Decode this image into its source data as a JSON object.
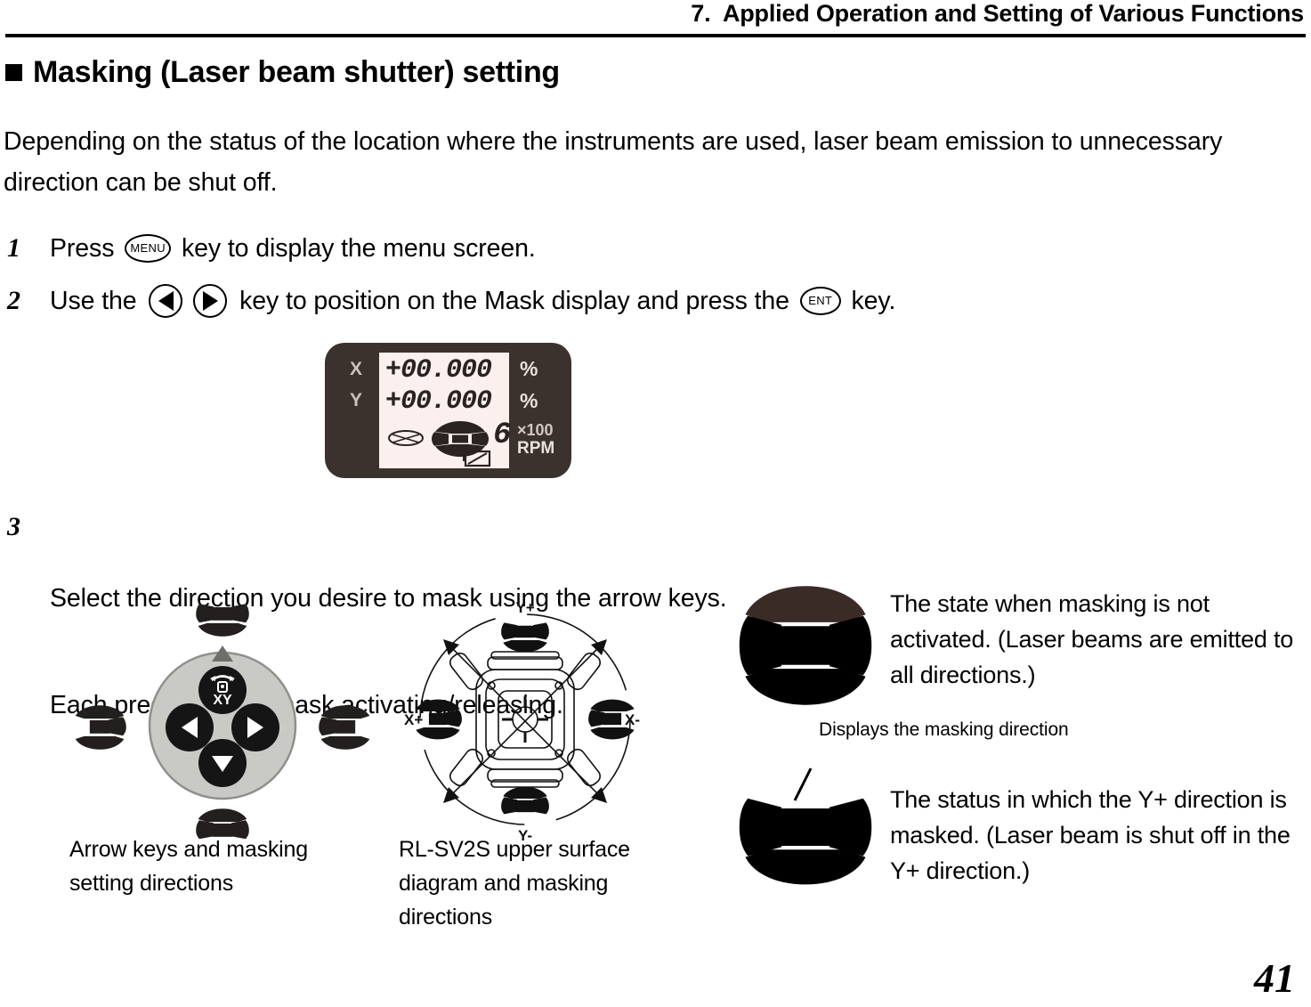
{
  "header": {
    "title": "7.  Applied Operation and Setting of Various Functions"
  },
  "section": {
    "heading": "Masking (Laser beam shutter) setting",
    "intro": "Depending on the status of the location where the instruments are used, laser beam emission to unnecessary direction can be shut off."
  },
  "steps": [
    {
      "number": "1",
      "text_before": "Press ",
      "key1": "MENU",
      "text_after": " key to display the menu screen."
    },
    {
      "number": "2",
      "text_before": "Use the ",
      "key_left": "left-arrow",
      "key_right": "right-arrow",
      "text_middle": " key to position on the Mask display and press the ",
      "key2": "ENT",
      "text_after": " key."
    },
    {
      "number": "3",
      "line1": "Select the direction you desire to mask using the arrow keys.",
      "line2": "Each press repeats mask activating/releasing."
    }
  ],
  "lcd": {
    "x_label": "X",
    "y_label": "Y",
    "x_value": "+00.000",
    "y_value": "+00.000",
    "unit_pct_1": "%",
    "unit_pct_2": "%",
    "unit_x100": "×100",
    "unit_rpm": "RPM",
    "rpm_digit": "6",
    "bezel_color": "#3b322e",
    "screen_color": "#fbf0ee",
    "segment_color": "#2a2320"
  },
  "diagrams": {
    "keypad": {
      "caption": "Arrow keys and masking setting directions",
      "center_button_label": "XY",
      "mask_icons": [
        "mask-icon-up",
        "mask-icon-left",
        "mask-icon-right",
        "mask-icon-down"
      ],
      "keys": [
        "up-arrow-key",
        "left-arrow-key",
        "right-arrow-key",
        "down-arrow-key"
      ]
    },
    "device": {
      "caption": "RL-SV2S upper surface diagram and masking directions",
      "label_y_plus": "Y+",
      "label_y_minus": "Y-",
      "label_x_plus": "X+",
      "label_x_minus": "X-"
    }
  },
  "legend": {
    "unmasked_text": "The state when masking is not activated. (Laser beams are emitted to all directions.)",
    "masked_text": "The status in which the Y+ direction is masked. (Laser beam is shut off in the Y+ direction.)",
    "masked_callout": "Displays the masking direction"
  },
  "footer": {
    "page_number": "41"
  }
}
